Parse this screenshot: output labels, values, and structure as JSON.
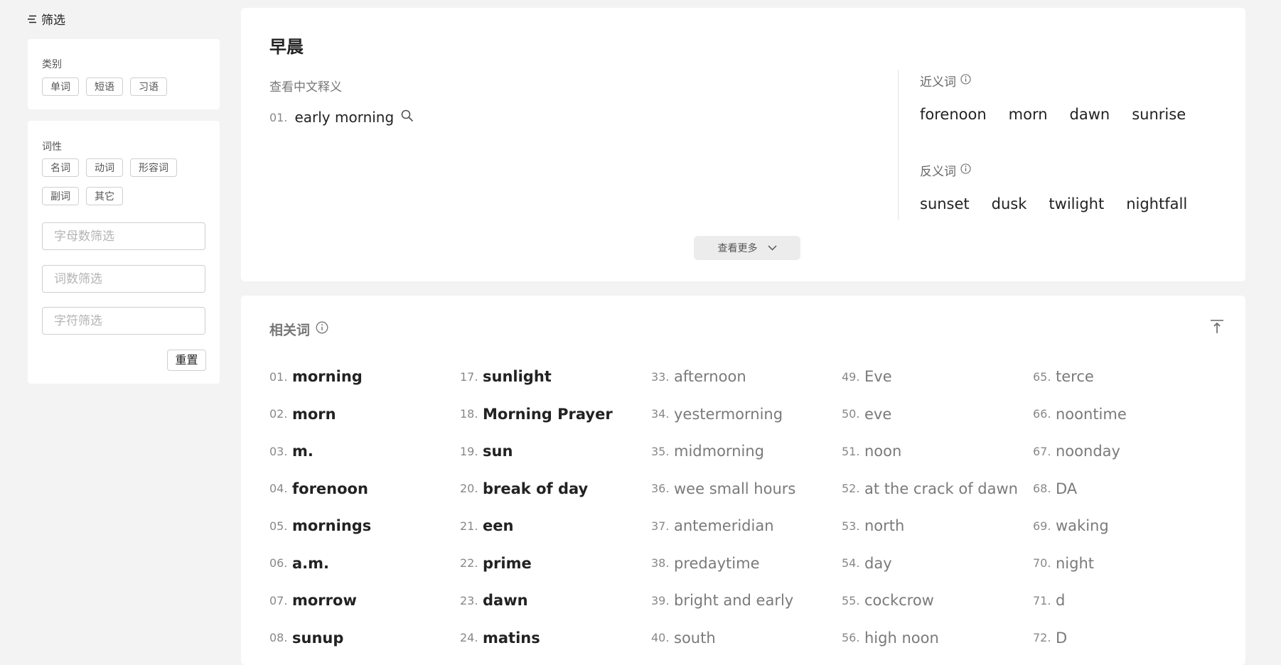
{
  "sidebar": {
    "title": "筛选",
    "category": {
      "label": "类别",
      "chips": [
        "单词",
        "短语",
        "习语"
      ]
    },
    "pos": {
      "label": "词性",
      "chips_row1": [
        "名词",
        "动词",
        "形容词"
      ],
      "chips_row2": [
        "副词",
        "其它"
      ]
    },
    "inputs": {
      "letters": "字母数筛选",
      "words": "词数筛选",
      "chars": "字符筛选"
    },
    "reset": "重置"
  },
  "entry": {
    "title": "早晨",
    "definition_label": "查看中文释义",
    "definition": {
      "num": "01.",
      "text": "early morning"
    },
    "synonyms": {
      "label": "近义词",
      "words": [
        "forenoon",
        "morn",
        "dawn",
        "sunrise"
      ]
    },
    "antonyms": {
      "label": "反义词",
      "words": [
        "sunset",
        "dusk",
        "twilight",
        "nightfall"
      ]
    },
    "more": "查看更多"
  },
  "related": {
    "title": "相关词",
    "columns": [
      [
        {
          "num": "01.",
          "word": "morning"
        },
        {
          "num": "02.",
          "word": "morn"
        },
        {
          "num": "03.",
          "word": "m."
        },
        {
          "num": "04.",
          "word": "forenoon"
        },
        {
          "num": "05.",
          "word": "mornings"
        },
        {
          "num": "06.",
          "word": "a.m."
        },
        {
          "num": "07.",
          "word": "morrow"
        },
        {
          "num": "08.",
          "word": "sunup"
        }
      ],
      [
        {
          "num": "17.",
          "word": "sunlight"
        },
        {
          "num": "18.",
          "word": "Morning Prayer"
        },
        {
          "num": "19.",
          "word": "sun"
        },
        {
          "num": "20.",
          "word": "break of day"
        },
        {
          "num": "21.",
          "word": "een"
        },
        {
          "num": "22.",
          "word": "prime"
        },
        {
          "num": "23.",
          "word": "dawn"
        },
        {
          "num": "24.",
          "word": "matins"
        }
      ],
      [
        {
          "num": "33.",
          "word": "afternoon"
        },
        {
          "num": "34.",
          "word": "yestermorning"
        },
        {
          "num": "35.",
          "word": "midmorning"
        },
        {
          "num": "36.",
          "word": "wee small hours"
        },
        {
          "num": "37.",
          "word": "antemeridian"
        },
        {
          "num": "38.",
          "word": "predaytime"
        },
        {
          "num": "39.",
          "word": "bright and early"
        },
        {
          "num": "40.",
          "word": "south"
        }
      ],
      [
        {
          "num": "49.",
          "word": "Eve"
        },
        {
          "num": "50.",
          "word": "eve"
        },
        {
          "num": "51.",
          "word": "noon"
        },
        {
          "num": "52.",
          "word": "at the crack of dawn"
        },
        {
          "num": "53.",
          "word": "north"
        },
        {
          "num": "54.",
          "word": "day"
        },
        {
          "num": "55.",
          "word": "cockcrow"
        },
        {
          "num": "56.",
          "word": "high noon"
        }
      ],
      [
        {
          "num": "65.",
          "word": "terce"
        },
        {
          "num": "66.",
          "word": "noontime"
        },
        {
          "num": "67.",
          "word": "noonday"
        },
        {
          "num": "68.",
          "word": "DA"
        },
        {
          "num": "69.",
          "word": "waking"
        },
        {
          "num": "70.",
          "word": "night"
        },
        {
          "num": "71.",
          "word": "d"
        },
        {
          "num": "72.",
          "word": "D"
        }
      ]
    ]
  }
}
